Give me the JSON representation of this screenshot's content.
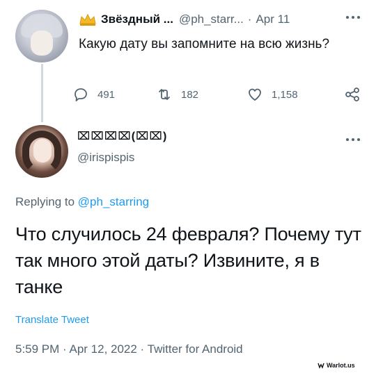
{
  "parent_tweet": {
    "display_name": "Звёздный ...",
    "handle": "@ph_starr...",
    "separator": "·",
    "date": "Apr 11",
    "text": "Какую дату вы запомните на всю жизнь?",
    "actions": {
      "reply_count": "491",
      "retweet_count": "182",
      "like_count": "1,158"
    },
    "icons": [
      "crown-icon",
      "more-icon",
      "reply-icon",
      "retweet-icon",
      "like-icon",
      "share-icon"
    ]
  },
  "reply_tweet": {
    "display_name": "⌧⌧⌧⌧(⌧⌧)",
    "handle": "@irispispis",
    "replying_prefix": "Replying to",
    "replying_to": "@ph_starring",
    "text": "Что случилось 24 февраля? Почему тут так много этой даты? Извините, я в танке",
    "translate_label": "Translate Tweet",
    "timestamp": "5:59 PM · Apr 12, 2022 · Twitter for Android"
  },
  "watermark": "Warlot.us",
  "colors": {
    "link": "#1d9bf0",
    "secondary_text": "#536471",
    "primary_text": "#0f1419",
    "thread_line": "#cfd9de"
  }
}
